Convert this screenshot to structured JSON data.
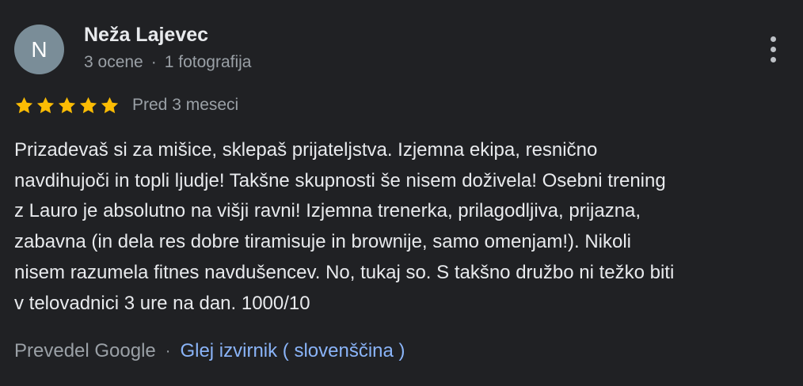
{
  "review": {
    "author": {
      "initial": "N",
      "name": "Neža Lajevec",
      "reviews_count": "3 ocene",
      "photos_count": "1 fotografija",
      "separator": "·"
    },
    "rating": {
      "stars": 5,
      "max_stars": 5,
      "star_color": "#fbbc04"
    },
    "date": "Pred 3 meseci",
    "lines": [
      "Prizadevaš si za mišice, sklepaš prijateljstva. Izjemna ekipa, resnično",
      "navdihujoči in topli ljudje! Takšne skupnosti še nisem doživela! Osebni trening",
      "z Lauro je absolutno na višji ravni! Izjemna trenerka, prilagodljiva, prijazna,",
      "zabavna (in dela res dobre tiramisuje in brownije, samo omenjam!). Nikoli",
      "nisem razumela fitnes navdušencev. No, tukaj so. S takšno družbo ni težko biti",
      "v telovadnici 3 ure na dan. 1000/10"
    ],
    "translation": {
      "translated_by": "Prevedel Google",
      "separator": "·",
      "see_original": "Glej izvirnik ( slovenščina )"
    },
    "icons": {
      "more": "more-vert-icon",
      "star": "star-icon"
    }
  },
  "colors": {
    "background": "#202124",
    "avatar": "#7a8d98",
    "link": "#8ab4f8",
    "text": "#e8eaed",
    "secondary_text": "#9aa0a6"
  }
}
